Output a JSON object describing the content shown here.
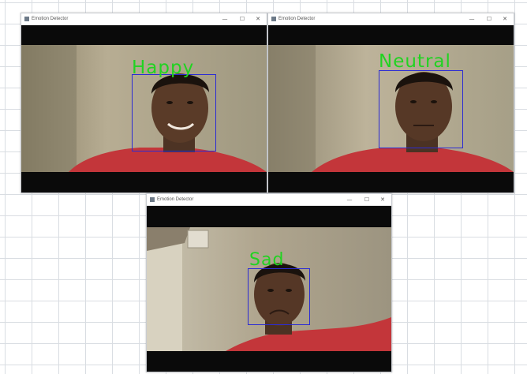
{
  "windows": [
    {
      "title": "Emotion Detector",
      "controls": {
        "minimize": "—",
        "maximize": "☐",
        "close": "✕"
      },
      "emotion_label": "Happy"
    },
    {
      "title": "Emotion Detector",
      "controls": {
        "minimize": "—",
        "maximize": "☐",
        "close": "✕"
      },
      "emotion_label": "Neutral"
    },
    {
      "title": "Emotion Detector",
      "controls": {
        "minimize": "—",
        "maximize": "☐",
        "close": "✕"
      },
      "emotion_label": "Sad"
    }
  ],
  "colors": {
    "label_green": "#21d321",
    "face_box_blue": "#2b2bd4",
    "letterbox": "#0a0a0a"
  }
}
